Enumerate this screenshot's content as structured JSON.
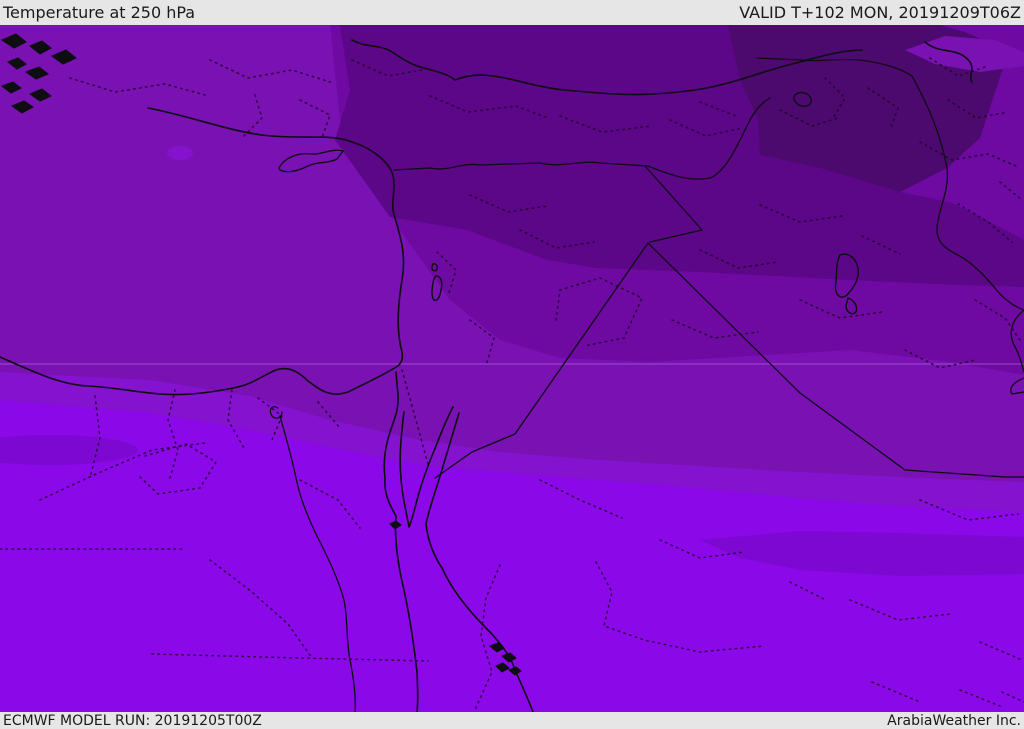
{
  "header": {
    "title": "Temperature at 250 hPa",
    "valid": "VALID T+102 MON, 20191209T06Z"
  },
  "footer": {
    "model_run": "ECMWF MODEL RUN: 20191205T00Z",
    "credit": "ArabiaWeather Inc."
  },
  "map": {
    "parameter": "Temperature",
    "level": "250 hPa",
    "model": "ECMWF",
    "bands": [
      {
        "name": "coldest",
        "color": "#4c0a6e"
      },
      {
        "name": "very-cold",
        "color": "#5c0688"
      },
      {
        "name": "cold",
        "color": "#6e0aa2"
      },
      {
        "name": "medium",
        "color": "#7911b3"
      },
      {
        "name": "mild",
        "color": "#8512cf"
      },
      {
        "name": "warm-overlay",
        "color": "#7d08d2"
      },
      {
        "name": "warmest",
        "color": "#8b09e8"
      }
    ],
    "line_colors": {
      "coast": "#0d0d12",
      "admin": "#1f0526",
      "graticule": "#e0c0f0"
    },
    "chrome": {
      "bar_bg": "#e6e6e6",
      "text": "#1a1a1a"
    }
  }
}
